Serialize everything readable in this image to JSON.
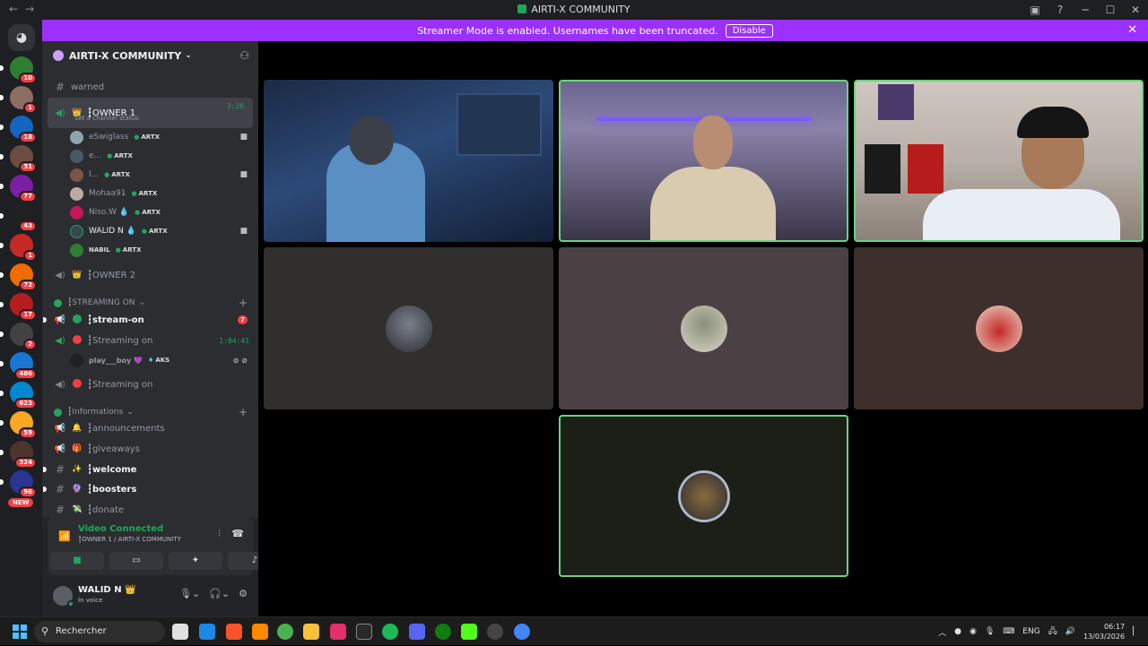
{
  "window": {
    "title": "AIRTI-X COMMUNITY",
    "nav_back": "←",
    "nav_forward": "→",
    "controls": [
      "▣",
      "?",
      "─",
      "☐",
      "✕"
    ]
  },
  "banner": {
    "message": "Streamer Mode is enabled. Usernames have been truncated.",
    "action": "Disable",
    "close": "✕"
  },
  "guilds": {
    "home_icon": "discord-icon",
    "badges": [
      "10",
      "1",
      "18",
      "31",
      "77",
      "43",
      "1",
      "72",
      "17",
      "2",
      "486",
      "623",
      "59",
      "324",
      "96"
    ],
    "new_label": "NEW"
  },
  "server": {
    "name": "AIRTI-X COMMUNITY",
    "chevron": "⌄"
  },
  "channels": {
    "warned": "warned",
    "owner1": {
      "emoji": "👑",
      "name": "┇OWNER 1",
      "timer": "3:26",
      "status": "Set a channel status"
    },
    "voice_users": [
      {
        "name": "eSwiglass",
        "tag": "ARTX"
      },
      {
        "name": "e...",
        "tag": "ARTX"
      },
      {
        "name": "l...",
        "tag": "ARTX"
      },
      {
        "name": "Mohaa91",
        "tag": "ARTX"
      },
      {
        "name": "Niso.W 💧",
        "tag": "ARTX"
      },
      {
        "name": "WALID N 💧",
        "tag": "ARTX"
      },
      {
        "name": "NABIL",
        "tag": "ARTX"
      }
    ],
    "owner2": {
      "emoji": "👑",
      "name": "┇OWNER 2"
    },
    "cat_streaming": "┇STREAMING ON",
    "stream_on": {
      "name": "┇stream-on",
      "mention": "7"
    },
    "streaming_on_1": {
      "name": "┇Streaming on",
      "timer": "1:04:41"
    },
    "stream_user": {
      "name": "play___boy 💜",
      "tag": "AKS"
    },
    "streaming_on_2": {
      "name": "┇Streaming on"
    },
    "cat_info": "┇Informations",
    "announcements": "┇announcements",
    "giveaways": "┇giveaways",
    "welcome": "┇welcome",
    "boosters": "┇boosters",
    "donate": "┇donate"
  },
  "voice_panel": {
    "status": "Video Connected",
    "location": "┇OWNER 1 / AIRTI-X COMMUNITY"
  },
  "user": {
    "name": "WALID N 👑",
    "status": "In voice"
  },
  "taskbar": {
    "search_placeholder": "Rechercher",
    "lang": "ENG",
    "time": "06:17",
    "date": "13/03/2026"
  },
  "colors": {
    "accent_banner": "#9b30ff",
    "speaking_border": "#6ad37f",
    "online": "#23a559",
    "alert": "#f23f43"
  }
}
